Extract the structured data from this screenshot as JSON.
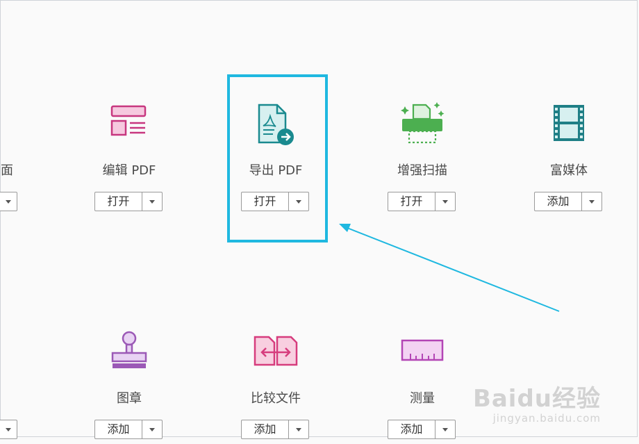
{
  "tools": [
    {
      "label": "面",
      "button": ""
    },
    {
      "label": "编辑 PDF",
      "button": "打开"
    },
    {
      "label": "导出 PDF",
      "button": "打开"
    },
    {
      "label": "增强扫描",
      "button": "打开"
    },
    {
      "label": "富媒体",
      "button": "添加"
    },
    {
      "label": "",
      "button": ""
    },
    {
      "label": "图章",
      "button": "添加"
    },
    {
      "label": "比较文件",
      "button": "添加"
    },
    {
      "label": "测量",
      "button": "添加"
    }
  ],
  "icons": {
    "edit_pdf": "edit-pdf-icon",
    "export_pdf": "export-pdf-icon",
    "enhance_scan": "enhance-scan-icon",
    "rich_media": "film-strip-icon",
    "stamp": "stamp-icon",
    "compare": "compare-files-icon",
    "measure": "ruler-icon"
  },
  "colors": {
    "highlight": "#1fb8e0",
    "edit": "#c7367f",
    "export": "#1a8a8f",
    "scan": "#4caf50",
    "media": "#1f7f86",
    "stamp": "#9b59b6",
    "compare": "#d63c7d",
    "measure": "#b345b5"
  },
  "watermark": {
    "logo": "Baidu经验",
    "url": "jingyan.baidu.com"
  }
}
